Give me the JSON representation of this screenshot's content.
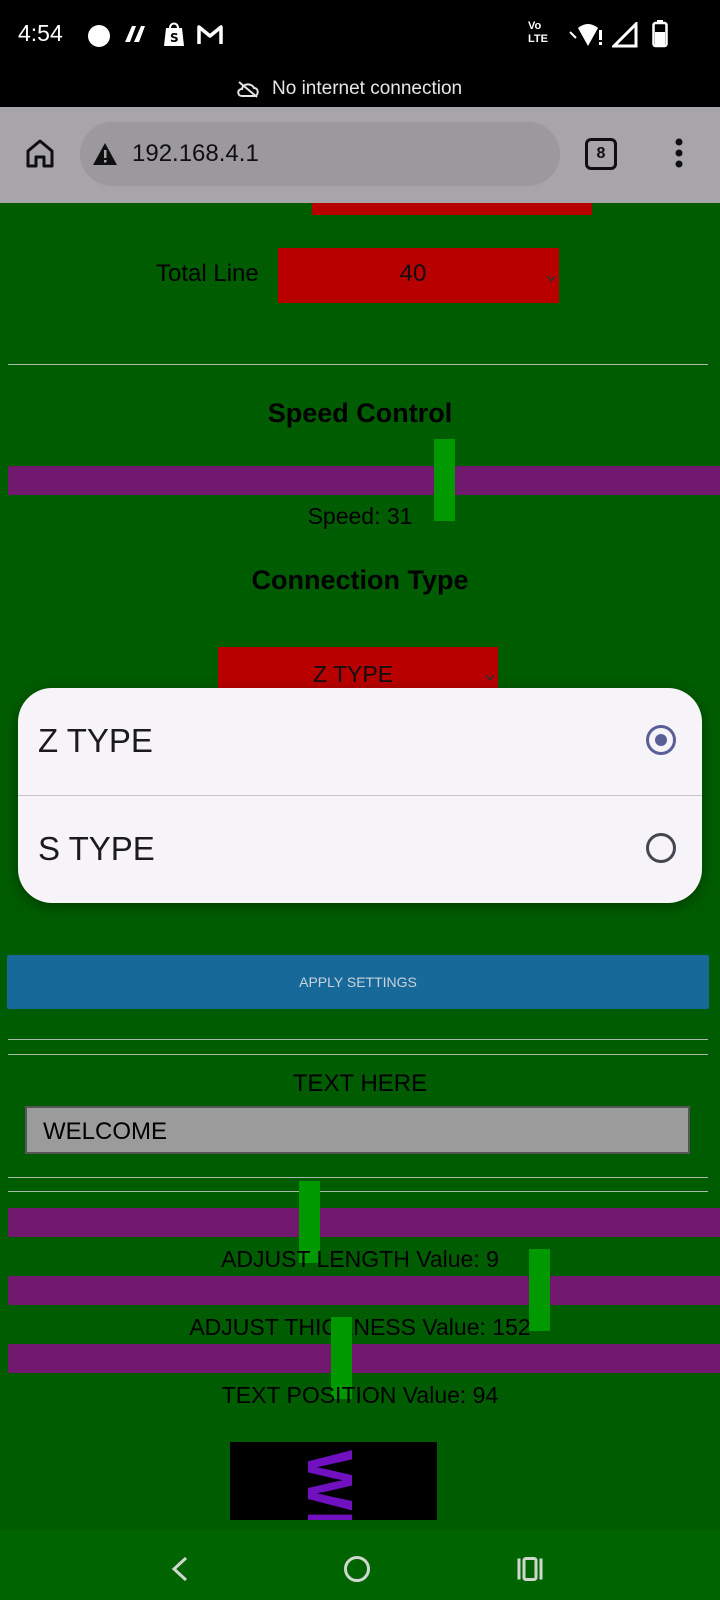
{
  "status_bar": {
    "time": "4:54",
    "network_label": "Vo LTE",
    "network_status": "No internet connection",
    "notification_icons": [
      "circle-icon",
      "app-icon",
      "shopify-icon",
      "gmail-icon"
    ]
  },
  "browser": {
    "url": "192.168.4.1",
    "tab_count": "8"
  },
  "total_line": {
    "label": "Total Line",
    "value": "40"
  },
  "speed_control": {
    "heading": "Speed Control",
    "value_text": "Speed: 31",
    "level": 0.61
  },
  "connection_type": {
    "heading": "Connection Type",
    "selected": "Z TYPE",
    "options": [
      {
        "label": "Z TYPE",
        "checked": true
      },
      {
        "label": "S TYPE",
        "checked": false
      }
    ]
  },
  "apply_button": "APPLY SETTINGS",
  "text_section": {
    "label": "TEXT HERE",
    "input_value": "WELCOME"
  },
  "adjust": {
    "length_text": "ADJUST LENGTH Value: 9",
    "length_level": 0.42,
    "thickness_text": "ADJUST THICKNESS Value: 152",
    "thickness_level": 0.74,
    "position_text": "TEXT POSITION Value: 94",
    "position_level": 0.46
  },
  "preview_text": "WE",
  "colors": {
    "page_bg": "#006400",
    "select_red": "#c80000",
    "slider_track": "#7a1c78",
    "slider_thumb": "#00a800",
    "apply_button": "#1a72a8"
  }
}
